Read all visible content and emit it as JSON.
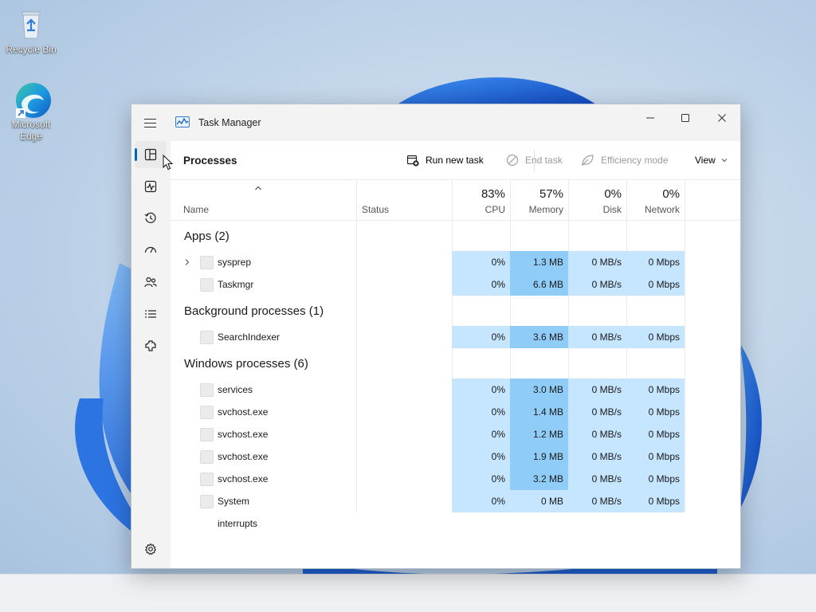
{
  "desktop": {
    "icons": [
      {
        "label": "Recycle Bin",
        "icon": "recycle-bin-icon"
      },
      {
        "label": "Microsoft Edge",
        "icon": "edge-icon"
      }
    ]
  },
  "window": {
    "title": "Task Manager",
    "controls": {
      "minimize": "minimize-icon",
      "maximize": "maximize-icon",
      "close": "close-icon"
    }
  },
  "nav": {
    "items": [
      {
        "name": "processes",
        "icon": "processes-icon",
        "active": true
      },
      {
        "name": "performance",
        "icon": "performance-icon"
      },
      {
        "name": "app-history",
        "icon": "app-history-icon"
      },
      {
        "name": "startup-apps",
        "icon": "startup-apps-icon"
      },
      {
        "name": "users",
        "icon": "users-icon"
      },
      {
        "name": "details",
        "icon": "details-icon"
      },
      {
        "name": "services",
        "icon": "services-icon"
      }
    ],
    "settings_icon": "settings-icon"
  },
  "toolbar": {
    "page_title": "Processes",
    "run_new_task": "Run new task",
    "end_task": "End task",
    "efficiency_mode": "Efficiency mode",
    "view": "View"
  },
  "columns": {
    "name": "Name",
    "status": "Status",
    "cpu": {
      "pct": "83%",
      "label": "CPU"
    },
    "memory": {
      "pct": "57%",
      "label": "Memory"
    },
    "disk": {
      "pct": "0%",
      "label": "Disk"
    },
    "network": {
      "pct": "0%",
      "label": "Network"
    }
  },
  "groups": [
    {
      "label": "Apps (2)",
      "processes": [
        {
          "name": "sysprep",
          "expandable": true,
          "cpu": "0%",
          "memory": "1.3 MB",
          "disk": "0 MB/s",
          "network": "0 Mbps"
        },
        {
          "name": "Taskmgr",
          "cpu": "0%",
          "memory": "6.6 MB",
          "disk": "0 MB/s",
          "network": "0 Mbps"
        }
      ]
    },
    {
      "label": "Background processes (1)",
      "processes": [
        {
          "name": "SearchIndexer",
          "cpu": "0%",
          "memory": "3.6 MB",
          "disk": "0 MB/s",
          "network": "0 Mbps"
        }
      ]
    },
    {
      "label": "Windows processes (6)",
      "processes": [
        {
          "name": "services",
          "cpu": "0%",
          "memory": "3.0 MB",
          "disk": "0 MB/s",
          "network": "0 Mbps"
        },
        {
          "name": "svchost.exe",
          "cpu": "0%",
          "memory": "1.4 MB",
          "disk": "0 MB/s",
          "network": "0 Mbps"
        },
        {
          "name": "svchost.exe",
          "cpu": "0%",
          "memory": "1.2 MB",
          "disk": "0 MB/s",
          "network": "0 Mbps"
        },
        {
          "name": "svchost.exe",
          "cpu": "0%",
          "memory": "1.9 MB",
          "disk": "0 MB/s",
          "network": "0 Mbps"
        },
        {
          "name": "svchost.exe",
          "cpu": "0%",
          "memory": "3.2 MB",
          "disk": "0 MB/s",
          "network": "0 Mbps"
        },
        {
          "name": "System interrupts",
          "cpu": "0%",
          "memory": "0 MB",
          "disk": "0 MB/s",
          "network": "0 Mbps"
        }
      ]
    }
  ],
  "colors": {
    "heat_light": "#dcefff",
    "heat_low": "#c6e5ff",
    "heat_mid": "#8fccf8",
    "accent": "#0067c0"
  }
}
